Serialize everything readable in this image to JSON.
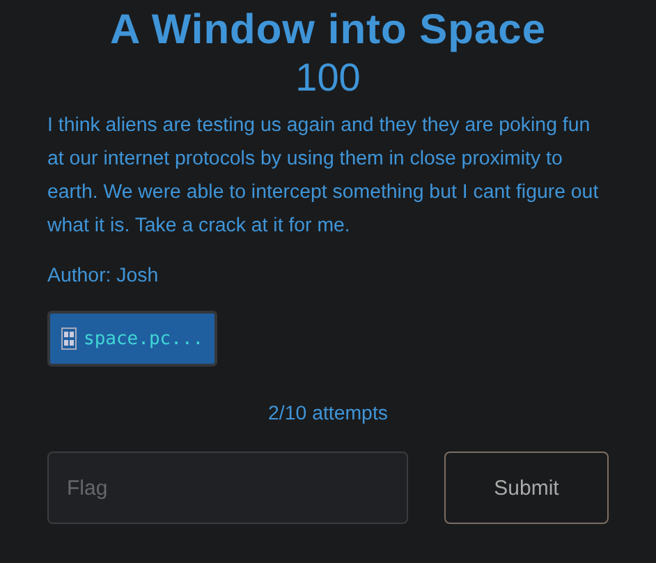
{
  "title": "A Window into Space",
  "points": "100",
  "description": "I think aliens are testing us again and they they are poking fun at our internet protocols by using them in close proximity to earth. We were able to intercept something but I cant figure out what it is. Take a crack at it for me.",
  "author": "Author: Josh",
  "files": [
    {
      "name": "space.pc..."
    }
  ],
  "attempts": "2/10 attempts",
  "flag_field": {
    "placeholder": "Flag"
  },
  "submit_button": "Submit"
}
